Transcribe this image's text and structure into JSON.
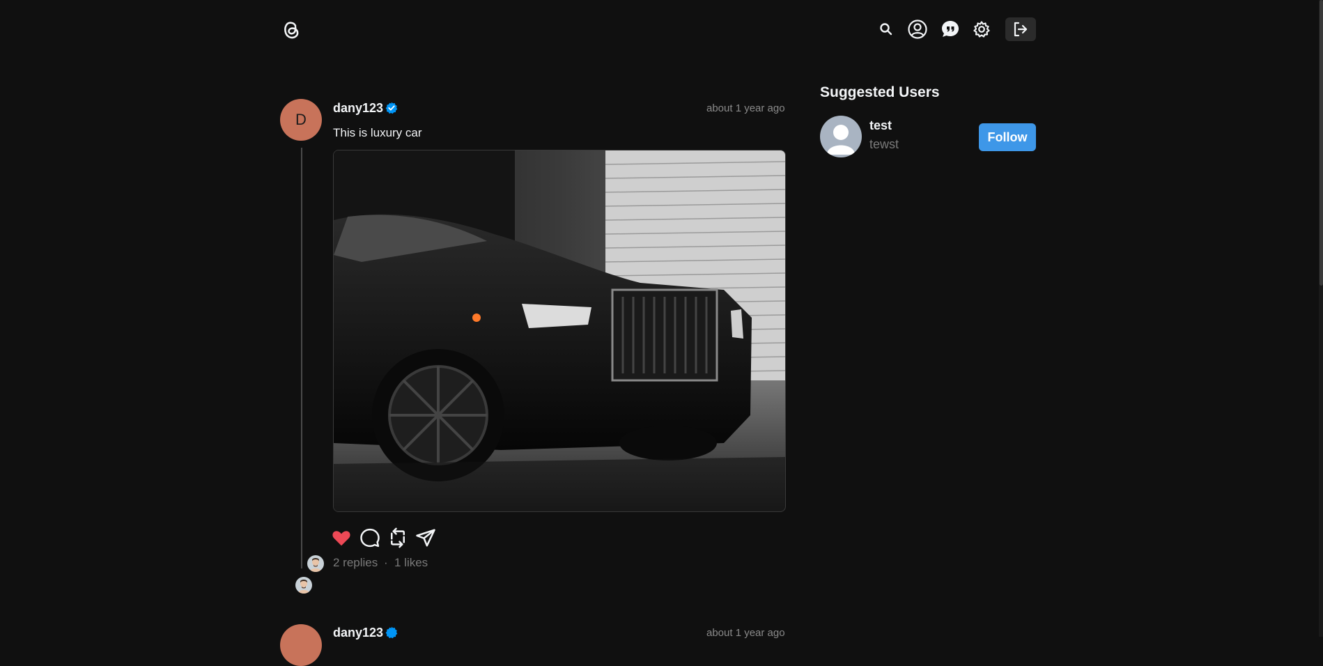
{
  "header": {
    "logo": "threads-logo-icon",
    "icons": [
      "search-icon",
      "profile-icon",
      "chat-icon",
      "settings-icon",
      "logout-icon"
    ]
  },
  "post": {
    "avatar_initial": "D",
    "username": "dany123",
    "verified": true,
    "timestamp": "about 1 year ago",
    "text": "This is luxury car",
    "image_alt": "black luxury car in garage",
    "liked": true,
    "colors": {
      "like": "#ed4956",
      "verified": "#0095f6"
    },
    "replies_text": "2 replies",
    "separator": "·",
    "likes_text": "1 likes"
  },
  "next_post": {
    "username": "dany123",
    "timestamp": "about 1 year ago"
  },
  "sidebar": {
    "title": "Suggested Users",
    "users": [
      {
        "name": "test",
        "handle": "tewst",
        "button": "Follow"
      }
    ]
  }
}
